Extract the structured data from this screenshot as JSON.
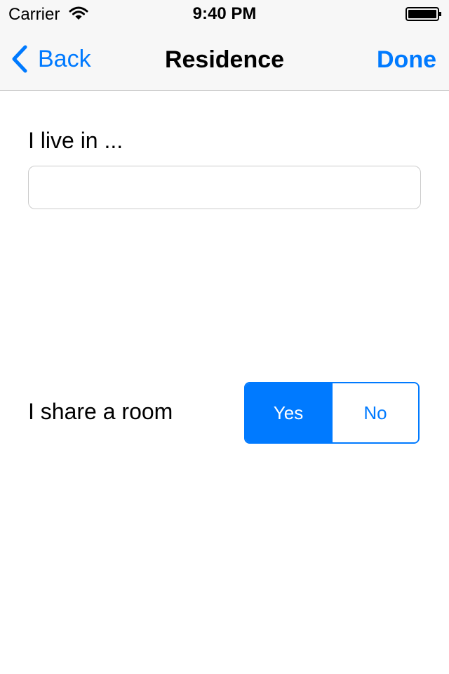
{
  "status_bar": {
    "carrier": "Carrier",
    "time": "9:40 PM",
    "wifi_icon": "wifi-icon",
    "battery_icon": "battery-icon"
  },
  "nav": {
    "back_label": "Back",
    "back_icon": "chevron-left-icon",
    "title": "Residence",
    "done_label": "Done"
  },
  "form": {
    "live_label": "I live in ...",
    "live_value": "",
    "live_placeholder": "",
    "share_label": "I share a room",
    "share_options": [
      "Yes",
      "No"
    ],
    "share_selected": "Yes"
  },
  "colors": {
    "accent": "#007aff",
    "nav_background": "#f7f7f7",
    "background": "#ffffff",
    "nav_border": "#b2b2b2",
    "field_border": "#cccccc"
  }
}
